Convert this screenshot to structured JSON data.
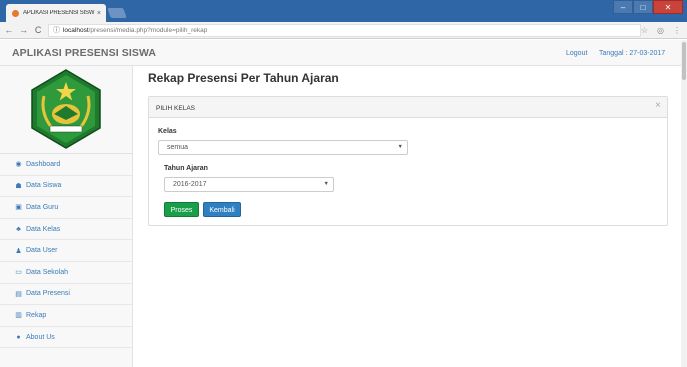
{
  "browser": {
    "tab_title": "APLIKASI PRESENSI SISW",
    "tab_close": "×",
    "url_host": "localhost",
    "url_path": "/presensi/media.php?module=pilih_rekap",
    "back_icon": "←",
    "forward_icon": "→",
    "reload_icon": "C",
    "info_icon": "ⓘ",
    "star_icon": "☆",
    "ext_icon": "◎",
    "menu_icon": "⋮",
    "win_min": "–",
    "win_max": "□",
    "win_close": "✕"
  },
  "header": {
    "brand": "APLIKASI PRESENSI SISWA",
    "logout": "Logout",
    "date": "Tanggal : 27-03-2017"
  },
  "sidebar": {
    "items": [
      {
        "icon": "dashboard-icon",
        "glyph": "◉",
        "label": "Dashboard"
      },
      {
        "icon": "users-icon",
        "glyph": "☗",
        "label": "Data Siswa"
      },
      {
        "icon": "teacher-icon",
        "glyph": "▣",
        "label": "Data Guru"
      },
      {
        "icon": "sitemap-icon",
        "glyph": "♣",
        "label": "Data Kelas"
      },
      {
        "icon": "user-icon",
        "glyph": "♟",
        "label": "Data User"
      },
      {
        "icon": "monitor-icon",
        "glyph": "▭",
        "label": "Data Sekolah"
      },
      {
        "icon": "table-icon",
        "glyph": "▤",
        "label": "Data Presensi"
      },
      {
        "icon": "bar-chart-icon",
        "glyph": "▥",
        "label": "Rekap"
      },
      {
        "icon": "info-icon",
        "glyph": "●",
        "label": "About Us"
      }
    ]
  },
  "main": {
    "title": "Rekap Presensi Per Tahun Ajaran",
    "panel_title": "PILIH KELAS",
    "panel_close": "×",
    "kelas_label": "Kelas",
    "kelas_value": "semua",
    "tahun_label": "Tahun Ajaran",
    "tahun_value": "2016-2017",
    "caret": "▼",
    "proses_label": "Proses",
    "kembali_label": "Kembali"
  },
  "colors": {
    "titlebar": "#2f67a6",
    "link": "#3a7ab8",
    "proses": "#199e4a",
    "kembali": "#2f80c0"
  }
}
